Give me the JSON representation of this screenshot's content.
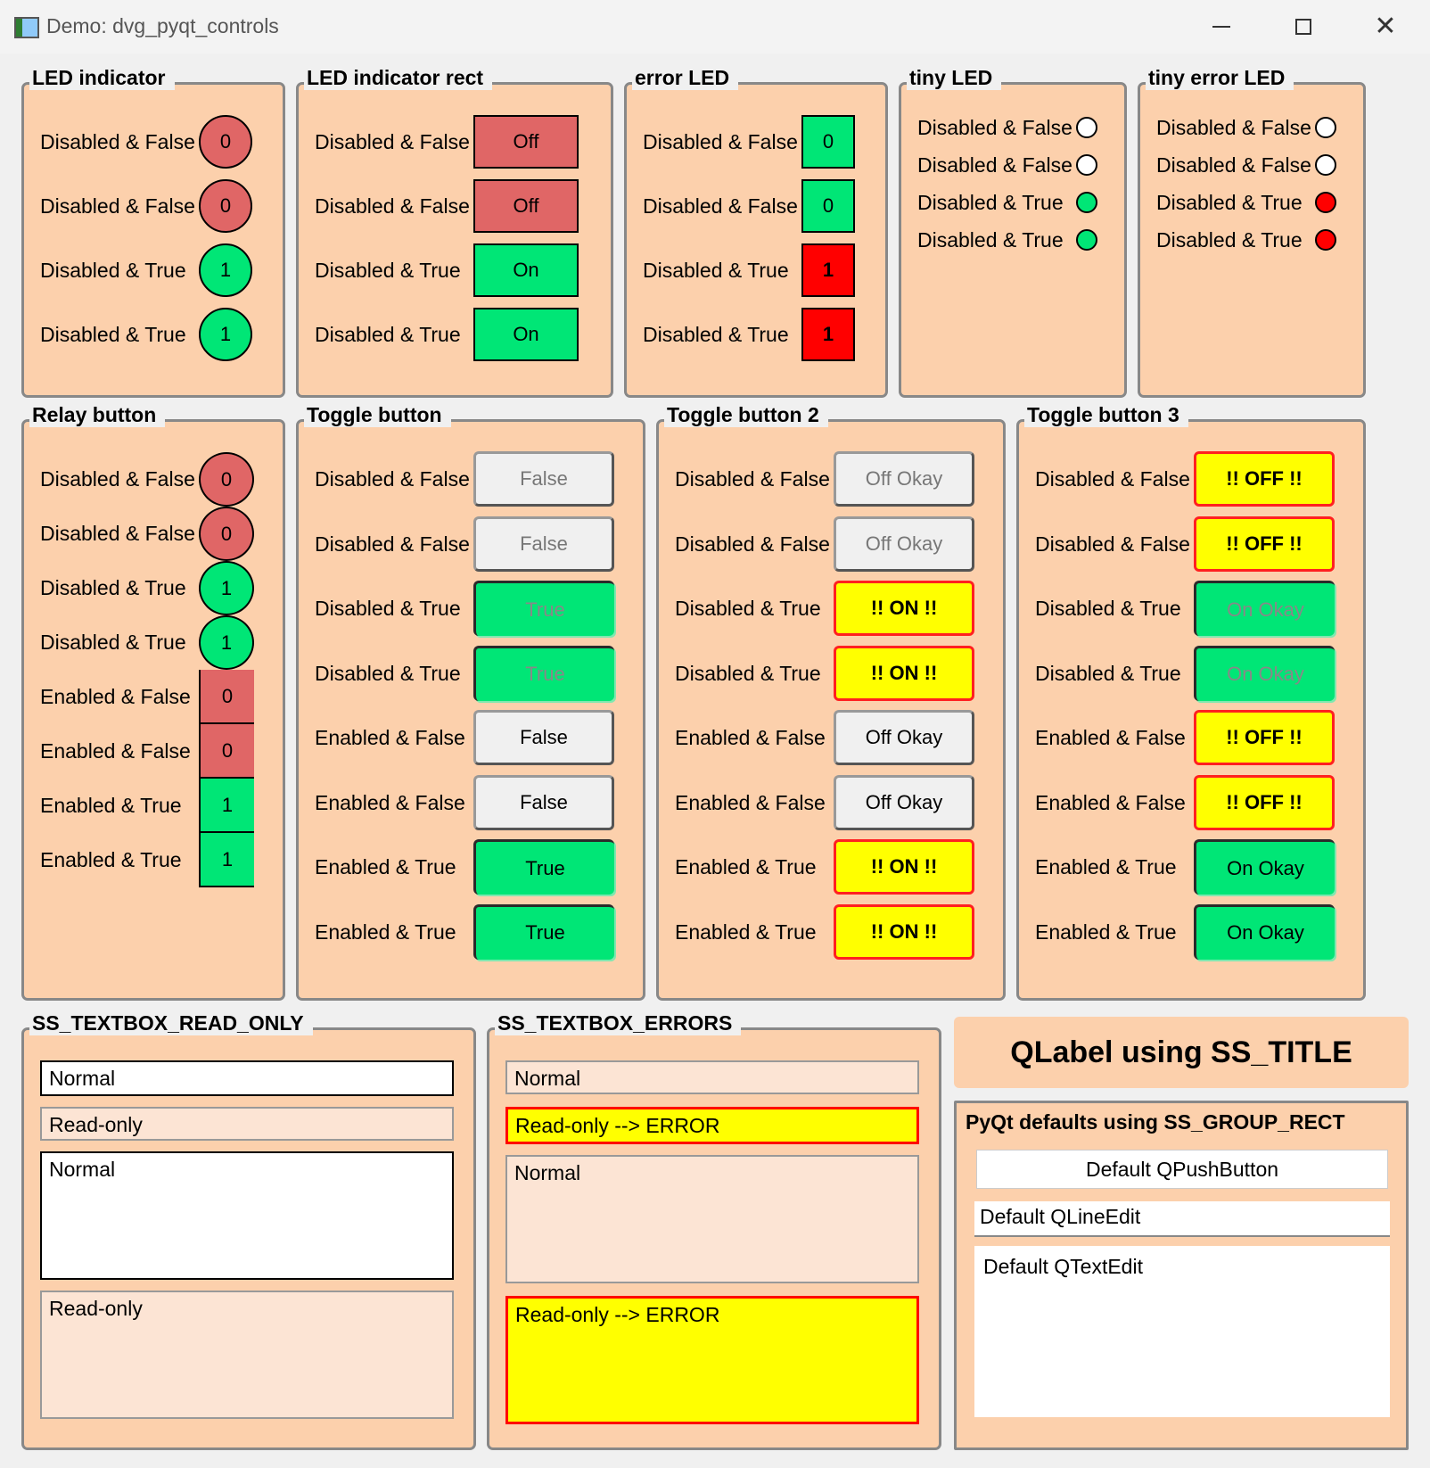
{
  "window": {
    "title": "Demo: dvg_pyqt_controls",
    "icon": "app-icon",
    "controls": [
      "minimize-icon",
      "maximize-icon",
      "close-icon"
    ]
  },
  "colors": {
    "group_bg": "#fcd0ac",
    "group_border": "#888888",
    "led_off": "#e06666",
    "led_on": "#00e676",
    "led_error": "#ff0000",
    "warning_yellow": "#ffff00",
    "readonly_bg": "#fce4d4",
    "button_off": "#f0f0f0"
  },
  "led_indicator": {
    "title": "LED indicator",
    "rows": [
      {
        "label": "Disabled & False",
        "value": "0",
        "state": "off"
      },
      {
        "label": "Disabled & False",
        "value": "0",
        "state": "off"
      },
      {
        "label": "Disabled & True",
        "value": "1",
        "state": "on"
      },
      {
        "label": "Disabled & True",
        "value": "1",
        "state": "on"
      }
    ]
  },
  "led_indicator_rect": {
    "title": "LED indicator rect",
    "rows": [
      {
        "label": "Disabled & False",
        "value": "Off",
        "state": "off"
      },
      {
        "label": "Disabled & False",
        "value": "Off",
        "state": "off"
      },
      {
        "label": "Disabled & True",
        "value": "On",
        "state": "on"
      },
      {
        "label": "Disabled & True",
        "value": "On",
        "state": "on"
      }
    ]
  },
  "error_led": {
    "title": "error LED",
    "rows": [
      {
        "label": "Disabled & False",
        "value": "0",
        "state": "ok"
      },
      {
        "label": "Disabled & False",
        "value": "0",
        "state": "ok"
      },
      {
        "label": "Disabled & True",
        "value": "1",
        "state": "error"
      },
      {
        "label": "Disabled & True",
        "value": "1",
        "state": "error"
      }
    ]
  },
  "tiny_led": {
    "title": "tiny LED",
    "rows": [
      {
        "label": "Disabled & False",
        "state": "off"
      },
      {
        "label": "Disabled & False",
        "state": "off"
      },
      {
        "label": "Disabled & True",
        "state": "on"
      },
      {
        "label": "Disabled & True",
        "state": "on"
      }
    ]
  },
  "tiny_error_led": {
    "title": "tiny error LED",
    "rows": [
      {
        "label": "Disabled & False",
        "state": "off"
      },
      {
        "label": "Disabled & False",
        "state": "off"
      },
      {
        "label": "Disabled & True",
        "state": "error"
      },
      {
        "label": "Disabled & True",
        "state": "error"
      }
    ]
  },
  "relay_button": {
    "title": "Relay button",
    "rows": [
      {
        "label": "Disabled & False",
        "value": "0",
        "state": "off",
        "enabled": false
      },
      {
        "label": "Disabled & False",
        "value": "0",
        "state": "off",
        "enabled": false
      },
      {
        "label": "Disabled & True",
        "value": "1",
        "state": "on",
        "enabled": false
      },
      {
        "label": "Disabled & True",
        "value": "1",
        "state": "on",
        "enabled": false
      },
      {
        "label": "Enabled & False",
        "value": "0",
        "state": "off",
        "enabled": true
      },
      {
        "label": "Enabled & False",
        "value": "0",
        "state": "off",
        "enabled": true
      },
      {
        "label": "Enabled & True",
        "value": "1",
        "state": "on",
        "enabled": true
      },
      {
        "label": "Enabled & True",
        "value": "1",
        "state": "on",
        "enabled": true
      }
    ]
  },
  "toggle_button": {
    "title": "Toggle button",
    "rows": [
      {
        "label": "Disabled & False",
        "value": "False",
        "state": "off",
        "enabled": false
      },
      {
        "label": "Disabled & False",
        "value": "False",
        "state": "off",
        "enabled": false
      },
      {
        "label": "Disabled & True",
        "value": "True",
        "state": "on",
        "enabled": false
      },
      {
        "label": "Disabled & True",
        "value": "True",
        "state": "on",
        "enabled": false
      },
      {
        "label": "Enabled & False",
        "value": "False",
        "state": "off",
        "enabled": true
      },
      {
        "label": "Enabled & False",
        "value": "False",
        "state": "off",
        "enabled": true
      },
      {
        "label": "Enabled & True",
        "value": "True",
        "state": "on",
        "enabled": true
      },
      {
        "label": "Enabled & True",
        "value": "True",
        "state": "on",
        "enabled": true
      }
    ]
  },
  "toggle_button_2": {
    "title": "Toggle button 2",
    "rows": [
      {
        "label": "Disabled & False",
        "value": "Off Okay",
        "state": "off",
        "enabled": false
      },
      {
        "label": "Disabled & False",
        "value": "Off Okay",
        "state": "off",
        "enabled": false
      },
      {
        "label": "Disabled & True",
        "value": "!! ON !!",
        "state": "warn",
        "enabled": false
      },
      {
        "label": "Disabled & True",
        "value": "!! ON !!",
        "state": "warn",
        "enabled": false
      },
      {
        "label": "Enabled & False",
        "value": "Off Okay",
        "state": "off",
        "enabled": true
      },
      {
        "label": "Enabled & False",
        "value": "Off Okay",
        "state": "off",
        "enabled": true
      },
      {
        "label": "Enabled & True",
        "value": "!! ON !!",
        "state": "warn",
        "enabled": true
      },
      {
        "label": "Enabled & True",
        "value": "!! ON !!",
        "state": "warn",
        "enabled": true
      }
    ]
  },
  "toggle_button_3": {
    "title": "Toggle button 3",
    "rows": [
      {
        "label": "Disabled & False",
        "value": "!! OFF !!",
        "state": "warn",
        "enabled": false
      },
      {
        "label": "Disabled & False",
        "value": "!! OFF !!",
        "state": "warn",
        "enabled": false
      },
      {
        "label": "Disabled & True",
        "value": "On Okay",
        "state": "on",
        "enabled": false
      },
      {
        "label": "Disabled & True",
        "value": "On Okay",
        "state": "on",
        "enabled": false
      },
      {
        "label": "Enabled & False",
        "value": "!! OFF !!",
        "state": "warn",
        "enabled": true
      },
      {
        "label": "Enabled & False",
        "value": "!! OFF !!",
        "state": "warn",
        "enabled": true
      },
      {
        "label": "Enabled & True",
        "value": "On Okay",
        "state": "on",
        "enabled": true
      },
      {
        "label": "Enabled & True",
        "value": "On Okay",
        "state": "on",
        "enabled": true
      }
    ]
  },
  "textbox_read_only": {
    "title": "SS_TEXTBOX_READ_ONLY",
    "line_normal": "Normal",
    "line_readonly": "Read-only",
    "text_normal": "Normal",
    "text_readonly": "Read-only"
  },
  "textbox_errors": {
    "title": "SS_TEXTBOX_ERRORS",
    "line_normal": "Normal",
    "line_error": "Read-only --> ERROR",
    "text_normal": "Normal",
    "text_error": "Read-only --> ERROR"
  },
  "title_label": "QLabel using SS_TITLE",
  "pyqt_defaults": {
    "title": "PyQt defaults using SS_GROUP_RECT",
    "button": "Default QPushButton",
    "lineedit": "Default QLineEdit",
    "textedit": "Default QTextEdit"
  }
}
